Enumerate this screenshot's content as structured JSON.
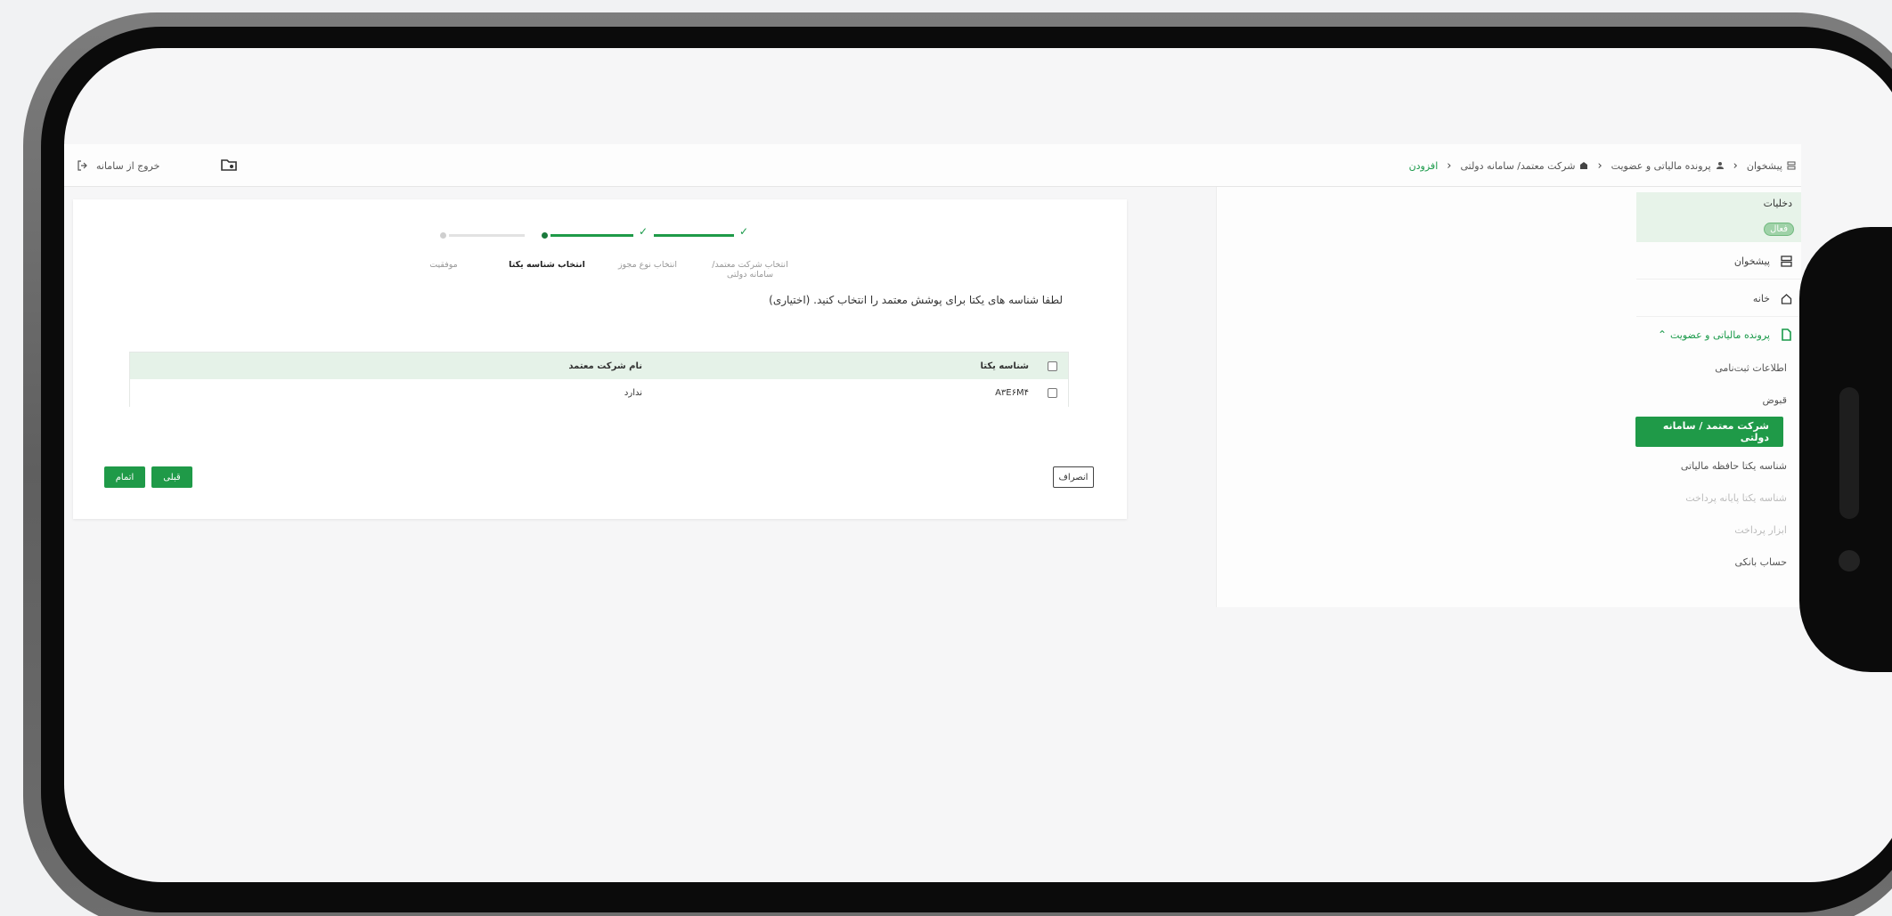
{
  "header": {
    "logout_label": "خروج از سامانه",
    "breadcrumb": [
      {
        "label": "پیشخوان",
        "icon": "dashboard-icon"
      },
      {
        "label": "پرونده مالیاتی و عضویت",
        "icon": "user-icon"
      },
      {
        "label": "شرکت معتمد/ سامانه دولتی",
        "icon": "building-icon"
      },
      {
        "label": "افزودن",
        "icon": ""
      }
    ]
  },
  "sidebar": {
    "user_name": "دخلیات",
    "status_badge": "فعال",
    "items": [
      {
        "label": "پیشخوان",
        "icon": "dashboard-icon"
      },
      {
        "label": "خانه",
        "icon": "home-icon"
      },
      {
        "label": "پرونده مالیاتی و عضویت",
        "icon": "file-icon"
      }
    ],
    "sub_items": [
      {
        "label": "اطلاعات ثبت‌نامی"
      },
      {
        "label": "قبوض"
      },
      {
        "label": "شرکت معتمد / سامانه دولتی"
      },
      {
        "label": "شناسه یکتا حافظه مالیاتی"
      },
      {
        "label": "شناسه یکتا پایانه پرداخت"
      },
      {
        "label": "ابزار پرداخت"
      },
      {
        "label": "حساب بانکی"
      }
    ]
  },
  "stepper": {
    "steps": [
      {
        "label": "انتخاب شرکت معتمد/سامانه دولتی",
        "status": "done"
      },
      {
        "label": "انتخاب نوع مجوز",
        "status": "done"
      },
      {
        "label": "انتخاب شناسه یکتا",
        "status": "current"
      },
      {
        "label": "موفقیت",
        "status": "pending"
      }
    ]
  },
  "main": {
    "instruction": "لطفا شناسه های یکتا برای پوشش معتمد را انتخاب کنید. (اختیاری)",
    "table": {
      "headers": [
        "شناسه یکتا",
        "نام شرکت معتمد"
      ],
      "rows": [
        [
          "A۳E۶M۴",
          "ندارد"
        ]
      ]
    },
    "buttons": {
      "cancel": "انصراف",
      "previous": "قبلی",
      "finish": "اتمام"
    }
  },
  "colors": {
    "accent": "#1f9a48",
    "accent_light": "#e5f2e8"
  }
}
